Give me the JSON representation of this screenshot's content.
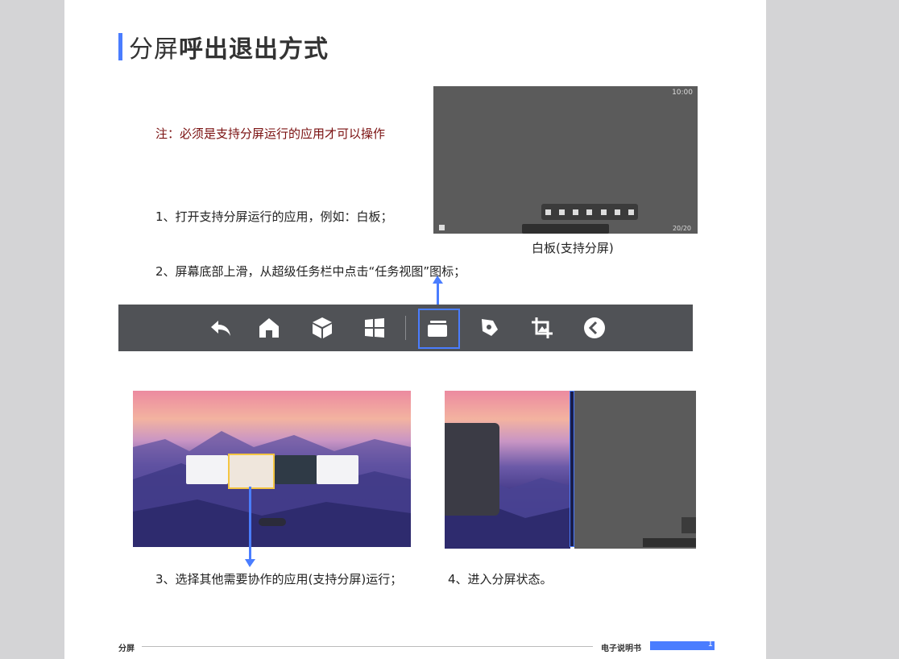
{
  "title": {
    "light": "分屏",
    "bold": "呼出退出方式"
  },
  "note": "注：必须是支持分屏运行的应用才可以操作",
  "steps": {
    "s1": "1、打开支持分屏运行的应用，例如：白板；",
    "s2": "2、屏幕底部上滑，从超级任务栏中点击“任务视图”图标；",
    "s3": "3、选择其他需要协作的应用(支持分屏)运行；",
    "s4": "4、进入分屏状态。"
  },
  "whiteboard": {
    "clock": "10:00",
    "page": "20/20"
  },
  "caption": "白板(支持分屏)",
  "taskbar": {
    "icons": [
      "back-icon",
      "home-icon",
      "cube-icon",
      "windows-icon",
      "task-view-icon",
      "annotate-icon",
      "screenshot-icon",
      "collapse-icon"
    ],
    "highlighted": "task-view-icon"
  },
  "footer": {
    "left": "分屏",
    "right": "电子说明书",
    "page": "1"
  },
  "colors": {
    "accent": "#4a7dff",
    "note": "#7a1010",
    "taskbar": "#505256"
  }
}
